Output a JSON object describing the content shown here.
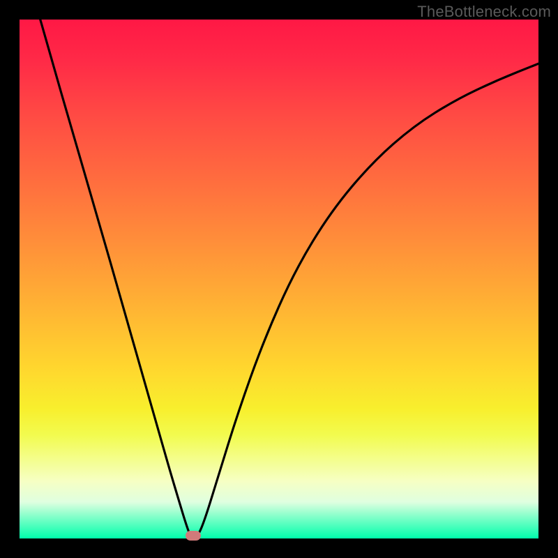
{
  "watermark": "TheBottleneck.com",
  "colors": {
    "background": "#000000",
    "watermark_text": "#5a5a5a",
    "curve_stroke": "#000000",
    "marker_fill": "#d17a7a",
    "gradient_top": "#ff1845",
    "gradient_bottom": "#00ffac"
  },
  "chart_data": {
    "type": "line",
    "title": "",
    "xlabel": "",
    "ylabel": "",
    "x_range": [
      0,
      100
    ],
    "y_range": [
      0,
      100
    ],
    "bottleneck_minimum_x": 33,
    "bottleneck_minimum_y": 0,
    "series": [
      {
        "name": "bottleneck-curve",
        "points": [
          {
            "x": 4.0,
            "y": 100.0
          },
          {
            "x": 6.0,
            "y": 93.0
          },
          {
            "x": 10.0,
            "y": 79.0
          },
          {
            "x": 15.0,
            "y": 62.0
          },
          {
            "x": 20.0,
            "y": 44.5
          },
          {
            "x": 24.0,
            "y": 30.5
          },
          {
            "x": 27.0,
            "y": 20.0
          },
          {
            "x": 29.0,
            "y": 13.0
          },
          {
            "x": 30.5,
            "y": 8.0
          },
          {
            "x": 32.0,
            "y": 3.0
          },
          {
            "x": 33.0,
            "y": 0.2
          },
          {
            "x": 34.2,
            "y": 0.2
          },
          {
            "x": 35.5,
            "y": 3.0
          },
          {
            "x": 38.0,
            "y": 11.0
          },
          {
            "x": 42.0,
            "y": 24.0
          },
          {
            "x": 47.0,
            "y": 38.0
          },
          {
            "x": 53.0,
            "y": 51.5
          },
          {
            "x": 60.0,
            "y": 63.0
          },
          {
            "x": 68.0,
            "y": 72.5
          },
          {
            "x": 76.0,
            "y": 79.5
          },
          {
            "x": 84.0,
            "y": 84.5
          },
          {
            "x": 92.0,
            "y": 88.3
          },
          {
            "x": 100.0,
            "y": 91.5
          }
        ]
      }
    ],
    "marker": {
      "x": 33.5,
      "y": 0.5
    },
    "gradient_meaning": "green = low bottleneck, red = high bottleneck"
  }
}
